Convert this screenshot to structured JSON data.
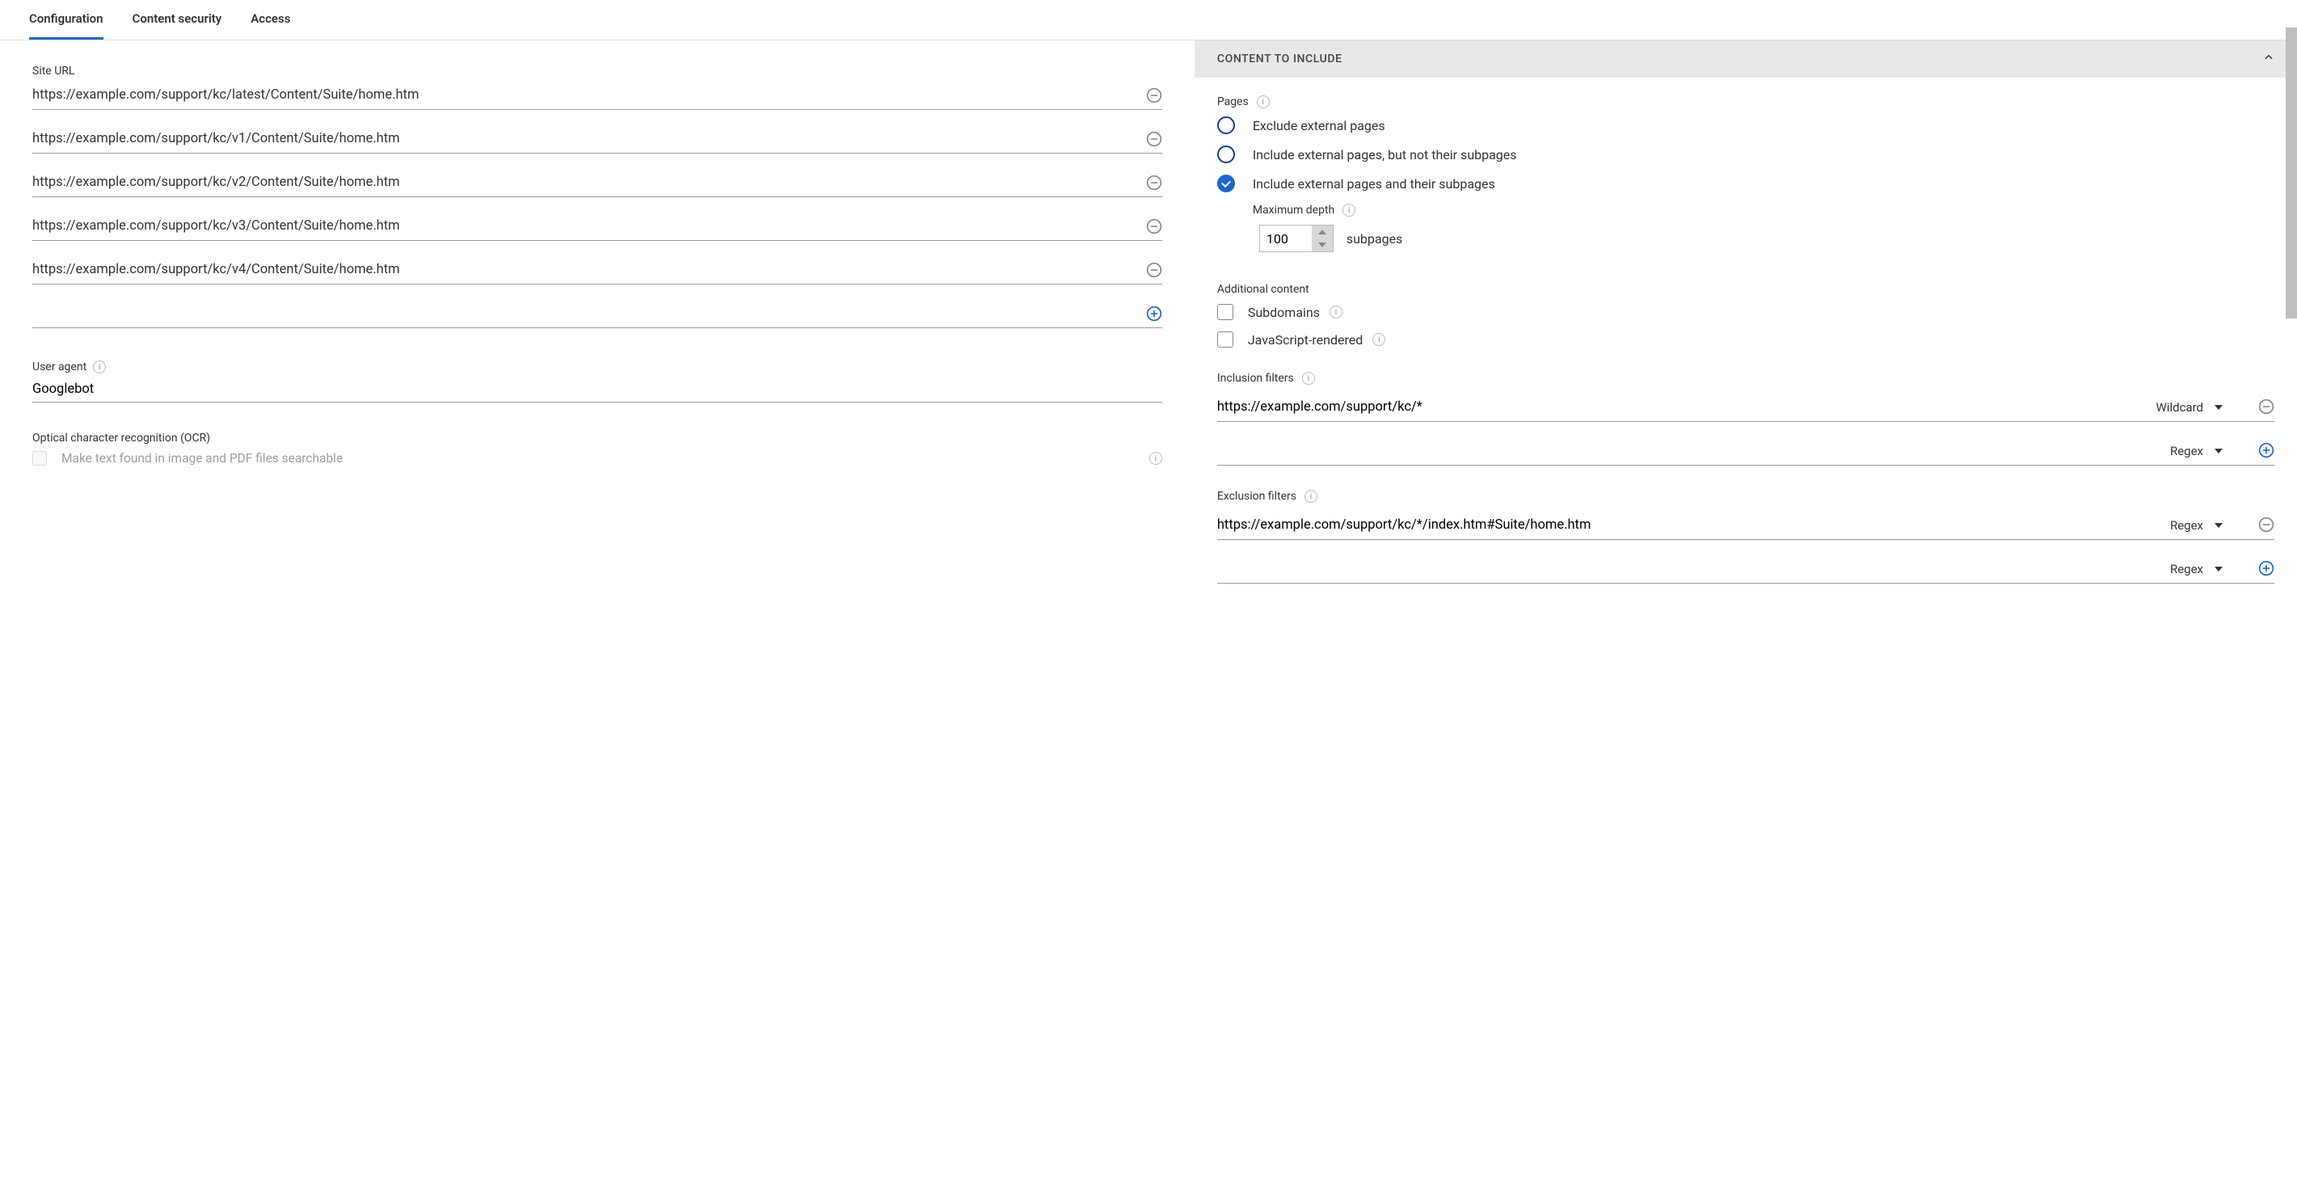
{
  "tabs": [
    {
      "label": "Configuration",
      "active": true
    },
    {
      "label": "Content security",
      "active": false
    },
    {
      "label": "Access",
      "active": false
    }
  ],
  "left": {
    "siteUrlLabel": "Site URL",
    "urls": [
      "https://example.com/support/kc/latest/Content/Suite/home.htm",
      "https://example.com/support/kc/v1/Content/Suite/home.htm",
      "https://example.com/support/kc/v2/Content/Suite/home.htm",
      "https://example.com/support/kc/v3/Content/Suite/home.htm",
      "https://example.com/support/kc/v4/Content/Suite/home.htm"
    ],
    "userAgentLabel": "User agent",
    "userAgentValue": "Googlebot",
    "ocrLabel": "Optical character recognition (OCR)",
    "ocrOption": "Make text found in image and PDF files searchable"
  },
  "right": {
    "sectionTitle": "CONTENT TO INCLUDE",
    "pagesLabel": "Pages",
    "pageOptions": [
      {
        "label": "Exclude external pages",
        "selected": false
      },
      {
        "label": "Include external pages, but not their subpages",
        "selected": false
      },
      {
        "label": "Include external pages and their subpages",
        "selected": true
      }
    ],
    "maxDepthLabel": "Maximum depth",
    "maxDepthValue": "100",
    "maxDepthSuffix": "subpages",
    "additionalLabel": "Additional content",
    "subdomainsLabel": "Subdomains",
    "jsRenderedLabel": "JavaScript-rendered",
    "inclusionLabel": "Inclusion filters",
    "inclusionFilters": [
      {
        "value": "https://example.com/support/kc/*",
        "type": "Wildcard",
        "action": "remove"
      },
      {
        "value": "",
        "type": "Regex",
        "action": "add"
      }
    ],
    "exclusionLabel": "Exclusion filters",
    "exclusionFilters": [
      {
        "value": "https://example.com/support/kc/*/index.htm#Suite/home.htm",
        "type": "Regex",
        "action": "remove"
      },
      {
        "value": "",
        "type": "Regex",
        "action": "add"
      }
    ]
  }
}
